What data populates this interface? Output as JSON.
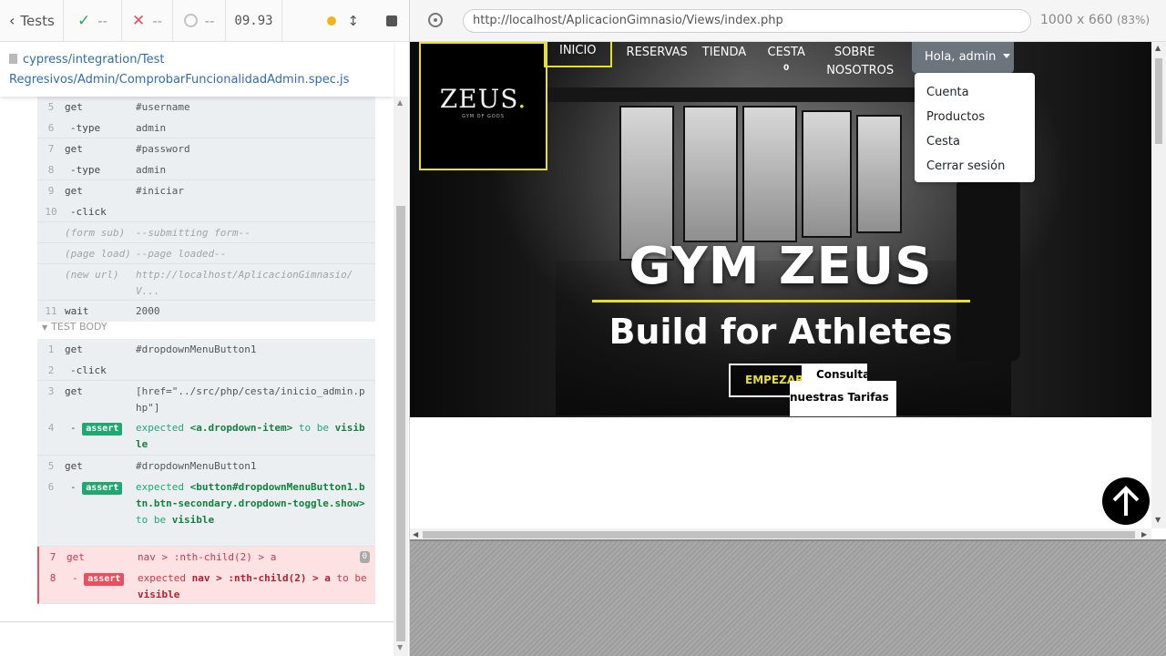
{
  "reporter": {
    "tests_label": "Tests",
    "passed": "--",
    "failed": "--",
    "pending": "--",
    "duration": "09.93",
    "spec_path_line1": "cypress/integration/Test",
    "spec_path_line2": "Regresivos/Admin/ComprobarFuncionalidadAdmin.spec.js",
    "section_test_body": "TEST BODY",
    "before_rows": [
      {
        "num": "5",
        "cmd": "get",
        "msg": "#username"
      },
      {
        "num": "6",
        "cmd": "-type",
        "msg": "admin"
      },
      {
        "num": "7",
        "cmd": "get",
        "msg": "#password"
      },
      {
        "num": "8",
        "cmd": "-type",
        "msg": "admin"
      },
      {
        "num": "9",
        "cmd": "get",
        "msg": "#iniciar"
      },
      {
        "num": "10",
        "cmd": "-click",
        "msg": ""
      },
      {
        "num": "",
        "cmd": "(form sub)",
        "msg": "--submitting form--"
      },
      {
        "num": "",
        "cmd": "(page load)",
        "msg": "--page loaded--"
      },
      {
        "num": "",
        "cmd": "(new url)",
        "msg": "http://localhost/AplicacionGimnasio/V..."
      },
      {
        "num": "11",
        "cmd": "wait",
        "msg": "2000"
      }
    ],
    "body_rows": [
      {
        "num": "1",
        "cmd": "get",
        "msg": "#dropdownMenuButton1"
      },
      {
        "num": "2",
        "cmd": "-click",
        "msg": ""
      },
      {
        "num": "3",
        "cmd": "get",
        "msg": "[href=\"../src/php/cesta/inicio_admin.php\"]"
      },
      {
        "num": "4",
        "cmd": "assert",
        "msg_pre": "expected ",
        "msg_el": "<a.dropdown-item>",
        "msg_mid": " to be ",
        "msg_end": "visible"
      },
      {
        "num": "5",
        "cmd": "get",
        "msg": "#dropdownMenuButton1"
      },
      {
        "num": "6",
        "cmd": "assert",
        "msg_pre": "expected ",
        "msg_el": "<button#dropdownMenuButton1.btn.btn-secondary.dropdown-toggle.show>",
        "msg_mid": " to be ",
        "msg_end": "visible"
      },
      {
        "num": "7",
        "cmd": "get",
        "msg": "nav > :nth-child(2) > a",
        "count": "0"
      },
      {
        "num": "8",
        "cmd": "assert",
        "msg_pre": "expected ",
        "msg_el": "nav > :nth-child(2) > a",
        "msg_mid": " to be ",
        "msg_end": "visible"
      }
    ]
  },
  "aut": {
    "url": "http://localhost/AplicacionGimnasio/Views/index.php",
    "viewport_size": "1000 x 660",
    "zoom": "(83%)",
    "logo_text": "ZEUS",
    "logo_dot": ".",
    "logo_sub": "GYM OF GODS",
    "nav": {
      "inicio": "INICIO",
      "reservas": "RESERVAS",
      "tienda": "TIENDA",
      "cesta": "CESTA",
      "cesta_count": "0",
      "sobre_line1": "SOBRE",
      "sobre_line2": "NOSOTROS"
    },
    "user_button": "Hola, admin",
    "dropdown_items": [
      "Cuenta",
      "Productos",
      "Cesta",
      "Cerrar sesión"
    ],
    "hero_title": "GYM ZEUS",
    "hero_subtitle": "Build for Athletes",
    "btn_empezar": "EMPEZAR",
    "btn_tarifas_line1": "Consulta",
    "btn_tarifas_line2": "nuestras Tarifas"
  },
  "colors": {
    "accent_yellow": "#e7df2a",
    "pass_green": "#1fa971",
    "fail_red": "#e94f5f",
    "link_blue": "#2f6db5"
  }
}
